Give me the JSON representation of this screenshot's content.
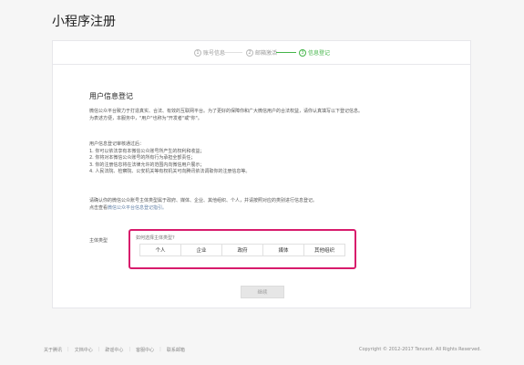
{
  "page": {
    "title": "小程序注册"
  },
  "steps": [
    {
      "num": "1",
      "label": "账号信息"
    },
    {
      "num": "2",
      "label": "邮箱激活"
    },
    {
      "num": "3",
      "label": "信息登记"
    }
  ],
  "section": {
    "title": "用户信息登记",
    "intro_1": "微信公众平台致力于打造真实、合法、有效的互联网平台。为了更好的保障你和广大微信用户的合法权益，请你认真填写以下登记信息。",
    "intro_2": "为表述方便，本服务中，\"用户\"也称为\"开发者\"或\"你\"。",
    "list_title": "用户信息登记审核通过后：",
    "list": [
      "1. 你可以依法享有本微信公众账号所产生的权利和收益；",
      "2. 你将对本微信公众账号的所有行为承担全部责任；",
      "3. 你的注册信息将在法律允许的范围内向微信用户展示；",
      "4. 人民法院、检察院、公安机关等有权机关可向腾讯依法调取你的注册信息等。"
    ],
    "confirm_text": "请确认你的微信公众账号主体类型属于政府、媒体、企业、其他组织、个人，并请按照对应的类别进行信息登记。",
    "link_prefix": "点击查看",
    "link_text": "微信公众平台信息登记指引。"
  },
  "subject": {
    "label": "主体类型",
    "hint": "如何选择主体类型?",
    "types": [
      "个人",
      "企业",
      "政府",
      "媒体",
      "其他组织"
    ]
  },
  "continue_button": "继续",
  "footer": {
    "links": [
      "关于腾讯",
      "文档中心",
      "辟谣中心",
      "客服中心",
      "联系邮箱"
    ],
    "copyright": "Copyright © 2012-2017 Tencent. All Rights Reserved."
  },
  "colors": {
    "accent": "#44b549",
    "highlight": "#d81b6c",
    "link": "#607fa6"
  }
}
